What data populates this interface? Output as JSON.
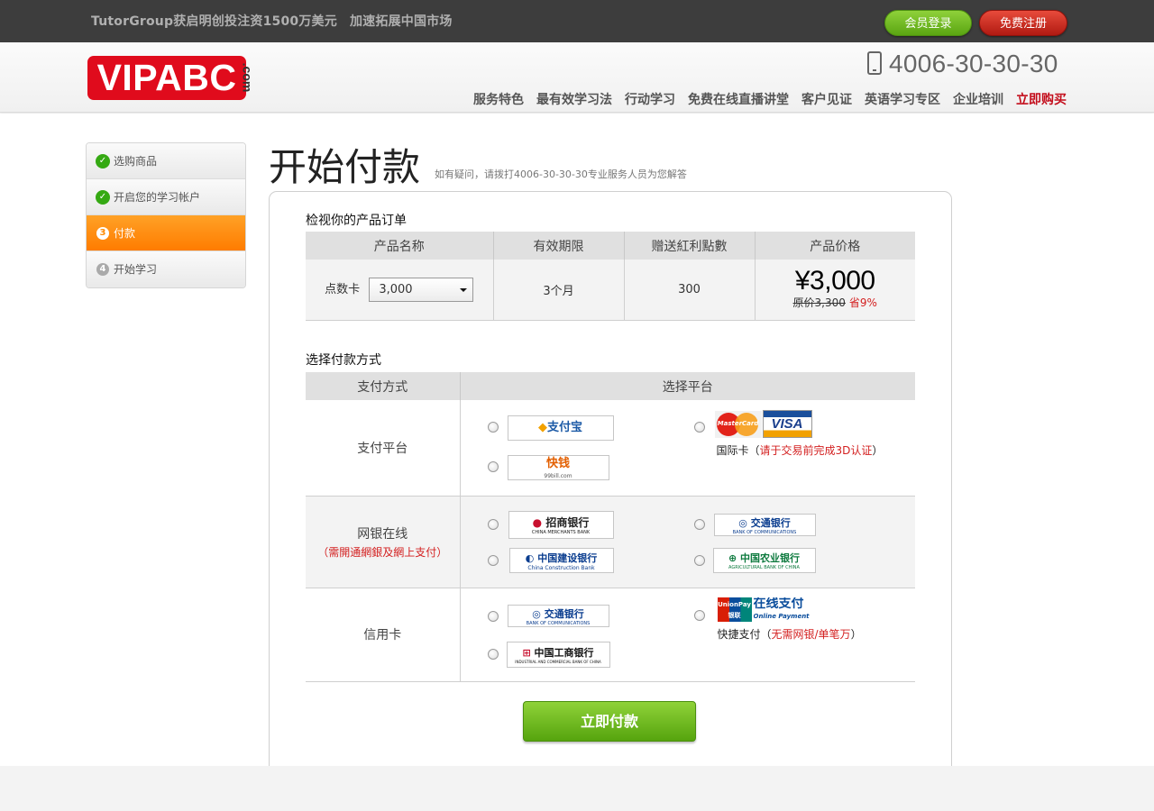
{
  "topbar": {
    "news_1": "TutorGroup获启明创投注资1500万美元",
    "news_2": "加速拓展中国市场",
    "login_label": "会员登录",
    "register_label": "免费注册"
  },
  "header": {
    "logo_text": "VIPABC",
    "logo_suffix": ".com",
    "phone": "4006-30-30-30",
    "nav": [
      "服务特色",
      "最有效学习法",
      "行动学习",
      "免费在线直播讲堂",
      "客户见证",
      "英语学习专区",
      "企业培训",
      "立即购买"
    ]
  },
  "steps": [
    {
      "icon": "✓",
      "label": "选购商品"
    },
    {
      "icon": "✓",
      "label": "开启您的学习帐户"
    },
    {
      "icon": "3",
      "label": "付款"
    },
    {
      "icon": "4",
      "label": "开始学习"
    }
  ],
  "page": {
    "title": "开始付款",
    "subtitle": "如有疑问，请拨打4006-30-30-30专业服务人员为您解答"
  },
  "order": {
    "section_title": "检视你的产品订单",
    "headers": [
      "产品名称",
      "有效期限",
      "赠送紅利點數",
      "产品价格"
    ],
    "product_label": "点数卡",
    "product_select": "3,000",
    "period": "3个月",
    "bonus": "300",
    "price": "¥3,000",
    "original_price": "原价3,300",
    "discount": "省9%"
  },
  "payment": {
    "section_title": "选择付款方式",
    "headers": [
      "支付方式",
      "选择平台"
    ],
    "platform_label": "支付平台",
    "netbank_label": "网银在线",
    "netbank_note": "（需開通網銀及網上支付）",
    "credit_label": "信用卡",
    "alipay": "支付宝",
    "kuaiqian": "快钱",
    "kuaiqian_url": "99bill.com",
    "mastercard": "MasterCard",
    "visa": "VISA",
    "intl_card_caption": "国际卡（",
    "intl_card_note": "请于交易前完成3D认证",
    "intl_card_end": "）",
    "cmb": "招商银行",
    "cmb_en": "CHINA MERCHANTS BANK",
    "bocom": "交通银行",
    "bocom_en": "BANK OF COMMUNICATIONS",
    "ccb": "中国建设银行",
    "ccb_en": "China Construction Bank",
    "abc": "中国农业银行",
    "abc_en": "AGRICULTURAL BANK OF CHINA",
    "icbc": "中国工商银行",
    "icbc_en": "INDUSTRIAL AND COMMERCIAL BANK OF CHINA",
    "unionpay": "UnionPay",
    "unionpay_cn": "银联",
    "online_pay": "在线支付",
    "online_pay_en": "Online Payment",
    "quick_caption": "快捷支付（",
    "quick_note": "无需网银/单笔万",
    "quick_end": "）"
  },
  "pay_button": "立即付款",
  "colors": {
    "brand_red": "#e00b1c",
    "active_orange": "#ff8a00",
    "button_green": "#6cbb1e"
  }
}
